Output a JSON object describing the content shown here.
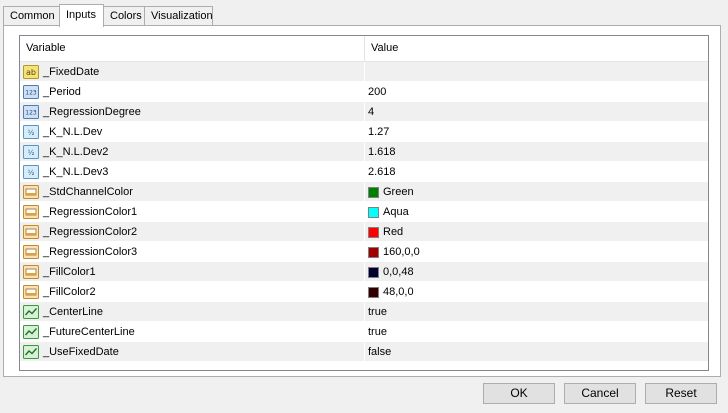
{
  "tabs": [
    "Common",
    "Inputs",
    "Colors",
    "Visualization"
  ],
  "table": {
    "headers": {
      "variable": "Variable",
      "value": "Value"
    },
    "rows": [
      {
        "name": "_FixedDate",
        "value": "",
        "icon": "string-icon"
      },
      {
        "name": "_Period",
        "value": "200",
        "icon": "integer-icon"
      },
      {
        "name": "_RegressionDegree",
        "value": "4",
        "icon": "integer-icon"
      },
      {
        "name": "_K_N.L.Dev",
        "value": "1.27",
        "icon": "double-icon"
      },
      {
        "name": "_K_N.L.Dev2",
        "value": "1.618",
        "icon": "double-icon"
      },
      {
        "name": "_K_N.L.Dev3",
        "value": "2.618",
        "icon": "double-icon"
      },
      {
        "name": "_StdChannelColor",
        "value": "Green",
        "icon": "color-icon",
        "swatch": "#008000"
      },
      {
        "name": "_RegressionColor1",
        "value": "Aqua",
        "icon": "color-icon",
        "swatch": "#00ffff"
      },
      {
        "name": "_RegressionColor2",
        "value": "Red",
        "icon": "color-icon",
        "swatch": "#ff0000"
      },
      {
        "name": "_RegressionColor3",
        "value": "160,0,0",
        "icon": "color-icon",
        "swatch": "#a00000"
      },
      {
        "name": "_FillColor1",
        "value": "0,0,48",
        "icon": "color-icon",
        "swatch": "#000030"
      },
      {
        "name": "_FillColor2",
        "value": "48,0,0",
        "icon": "color-icon",
        "swatch": "#300000"
      },
      {
        "name": "_CenterLine",
        "value": "true",
        "icon": "bool-icon"
      },
      {
        "name": "_FutureCenterLine",
        "value": "true",
        "icon": "bool-icon"
      },
      {
        "name": "_UseFixedDate",
        "value": "false",
        "icon": "bool-icon"
      }
    ]
  },
  "buttons": {
    "ok": "OK",
    "cancel": "Cancel",
    "reset": "Reset"
  }
}
